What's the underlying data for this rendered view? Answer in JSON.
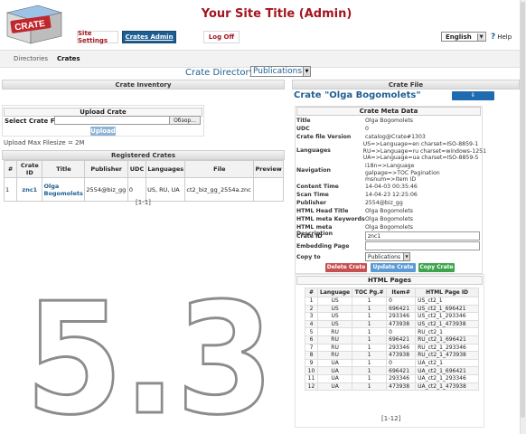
{
  "header": {
    "logo_text": "CRATE",
    "site_title": "Your Site Title (Admin)",
    "nav_buttons": {
      "site_settings": "Site Settings",
      "crates_admin": "Crates Admin",
      "log_off": "Log Off"
    },
    "language": "English",
    "help": "Help"
  },
  "breadcrumb": {
    "directories": "Directories",
    "crates": "Crates"
  },
  "crate_directory": {
    "label": "Crate Directory",
    "selected": "Publications"
  },
  "inventory": {
    "title": "Crate Inventory",
    "upload_title": "Upload Crate",
    "select_label": "Select Crate File",
    "browse": "Обзор...",
    "upload_button": "Upload",
    "max_filesize": "Upload Max Filesize = 2M"
  },
  "registered": {
    "title": "Registered Crates",
    "columns": [
      "#",
      "Crate ID",
      "Title",
      "Publisher",
      "UDC",
      "Languages",
      "File",
      "Preview"
    ],
    "rows": [
      {
        "num": "1",
        "crate_id": "znc1",
        "title": "Olga Bogomolets",
        "publisher": "2554@biz_gg",
        "udc": "0",
        "languages": "US, RU, UA",
        "file": "ct2_biz_gg_2554a.znc",
        "preview": ""
      }
    ],
    "pager": "[1-1]"
  },
  "watermark": "5.3",
  "crate_file": {
    "section_title": "Crate File",
    "title": "Crate \"Olga Bogomolets\"",
    "download": "DOWNLOAD",
    "meta_title": "Crate Meta Data",
    "meta": [
      {
        "k": "Title",
        "v": "Olga Bogomolets"
      },
      {
        "k": "UDC",
        "v": "0"
      },
      {
        "k": "Crate file Version",
        "v": "catalog@Crate#1303"
      },
      {
        "k": "Languages",
        "v": "US=>Language=en charset=ISO-8859-1\nRU=>Language=ru charset=windows-1251\nUA=>Language=ua charset=ISO-8859-5"
      },
      {
        "k": "Navigation",
        "v": "i18n=>Language\ngalpage=>TOC Pagination\nmsnum=>Item ID"
      },
      {
        "k": "Content Time",
        "v": "14-04-03 00:35:46"
      },
      {
        "k": "Scan Time",
        "v": "14-04-23 12:25:06"
      },
      {
        "k": "Publisher",
        "v": "2554@biz_gg"
      },
      {
        "k": "HTML Head Title",
        "v": "Olga Bogomolets"
      },
      {
        "k": "HTML meta Keywords",
        "v": "Olga Bogomolets"
      },
      {
        "k": "HTML meta Description",
        "v": "Olga Bogomolets"
      }
    ],
    "crate_id_label": "Crate ID",
    "crate_id_value": "znc1",
    "embedding_label": "Embedding Page",
    "embedding_value": "",
    "copy_to_label": "Copy to",
    "copy_to_value": "Publications",
    "buttons": {
      "delete": "Delete Crate",
      "update": "Update Crate",
      "copy": "Copy Crate"
    }
  },
  "html_pages": {
    "title": "HTML Pages",
    "columns": [
      "#",
      "Language",
      "TOC Pg.#",
      "Item#",
      "HTML Page ID"
    ],
    "rows": [
      [
        "1",
        "US",
        "1",
        "0",
        "US_ct2_1"
      ],
      [
        "2",
        "US",
        "1",
        "696421",
        "US_ct2_1_696421"
      ],
      [
        "3",
        "US",
        "1",
        "293346",
        "US_ct2_1_293346"
      ],
      [
        "4",
        "US",
        "1",
        "473938",
        "US_ct2_1_473938"
      ],
      [
        "5",
        "RU",
        "1",
        "0",
        "RU_ct2_1"
      ],
      [
        "6",
        "RU",
        "1",
        "696421",
        "RU_ct2_1_696421"
      ],
      [
        "7",
        "RU",
        "1",
        "293346",
        "RU_ct2_1_293346"
      ],
      [
        "8",
        "RU",
        "1",
        "473938",
        "RU_ct2_1_473938"
      ],
      [
        "9",
        "UA",
        "1",
        "0",
        "UA_ct2_1"
      ],
      [
        "10",
        "UA",
        "1",
        "696421",
        "UA_ct2_1_696421"
      ],
      [
        "11",
        "UA",
        "1",
        "293346",
        "UA_ct2_1_293346"
      ],
      [
        "12",
        "UA",
        "1",
        "473938",
        "UA_ct2_1_473938"
      ]
    ],
    "pager": "[1-12]"
  }
}
